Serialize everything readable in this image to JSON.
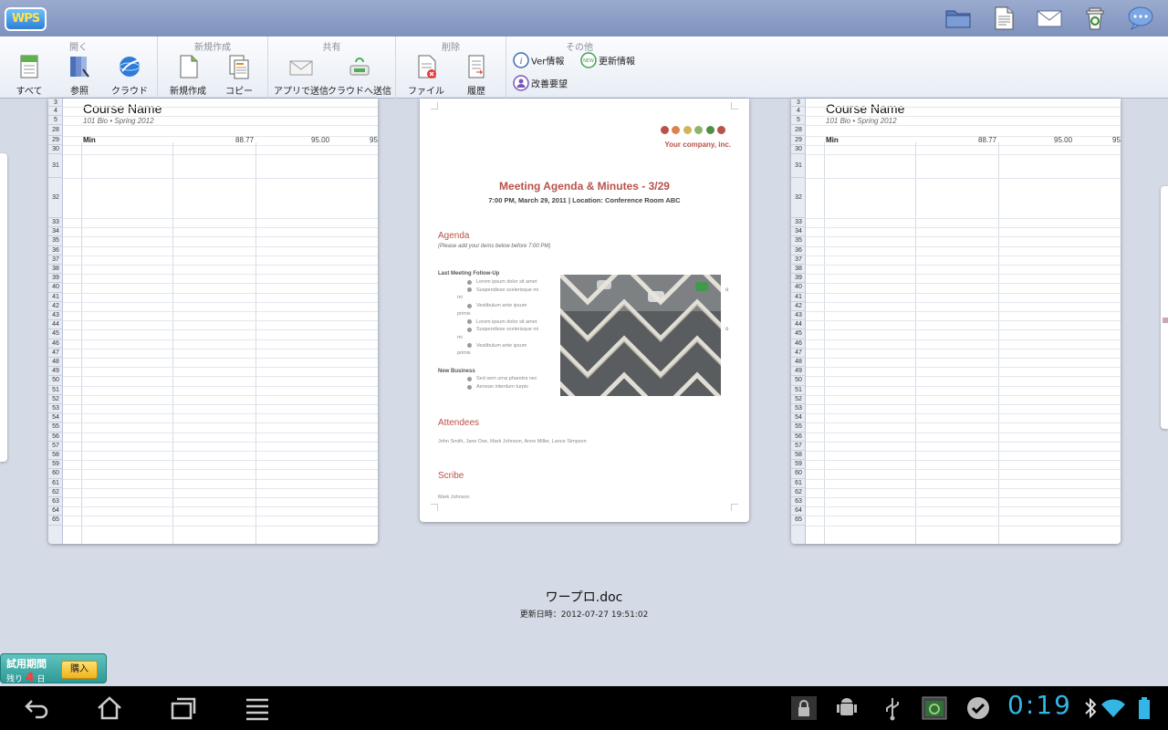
{
  "app": {
    "logo_text": "WPS"
  },
  "topbar_icons": [
    "folder-icon",
    "document-icon",
    "mail-icon",
    "recycle-bin-icon",
    "chat-bubble-icon"
  ],
  "ribbon": {
    "groups": [
      {
        "title": "開く",
        "buttons": [
          "すべて",
          "参照",
          "クラウド"
        ]
      },
      {
        "title": "新規作成",
        "buttons": [
          "新規作成",
          "コピー"
        ]
      },
      {
        "title": "共有",
        "buttons": [
          "アプリで送信",
          "クラウドへ送信"
        ]
      },
      {
        "title": "削除",
        "buttons": [
          "ファイル",
          "履歴"
        ]
      },
      {
        "title": "その他",
        "buttons": [
          "Ver情報",
          "更新情報",
          "改善要望"
        ]
      }
    ]
  },
  "sheet": {
    "title": "Course Name",
    "subtitle": "101 Bio • Spring 2012",
    "min_label": "Min",
    "values": [
      "88.77",
      "95.00",
      "95"
    ],
    "rows_top": [
      "3",
      "4",
      "5",
      "28",
      "29",
      "30",
      "31",
      "32"
    ],
    "rows": [
      "33",
      "34",
      "35",
      "36",
      "37",
      "38",
      "39",
      "40",
      "41",
      "42",
      "43",
      "44",
      "45",
      "46",
      "47",
      "48",
      "49",
      "50",
      "51",
      "52",
      "53",
      "54",
      "55",
      "56",
      "57",
      "58",
      "59",
      "60",
      "61",
      "62",
      "63",
      "64",
      "65"
    ]
  },
  "doc": {
    "company": "Your company, inc.",
    "dot_colors": [
      "#b8524a",
      "#d9834e",
      "#d2b55a",
      "#8db56d",
      "#4f8e48",
      "#b8524a"
    ],
    "title": "Meeting Agenda & Minutes - 3/29",
    "meta": "7:00 PM, March 29, 2011 | Location: Conference Room ABC",
    "agenda_heading": "Agenda",
    "agenda_note": "(Please add your items below before 7:00 PM)",
    "followup_heading": "Last Meeting Follow-Up",
    "followup_items": [
      "Lorem ipsum dolor sit amet",
      "Suspendisse scelerisque mi",
      "mi",
      "Vestibulum ante ipsum",
      "primis",
      "Lorem ipsum dolor sit amet",
      "Suspendisse scelerisque mi",
      "mi",
      "Vestibulum ante ipsum",
      "primis"
    ],
    "newbiz_heading": "New Business",
    "newbiz_items": [
      "Sed sem urna pharetra nec",
      "Aenean interdum turpis"
    ],
    "attendees_heading": "Attendees",
    "attendees": "John Smith, Jane Doe, Mark Johnson, Anne Miller, Lance Simpson",
    "scribe_heading": "Scribe",
    "scribe": "Mark Johnson"
  },
  "file": {
    "name": "ワープロ.doc",
    "modified": "更新日時：2012-07-27 19:51:02"
  },
  "trial": {
    "title": "試用期間",
    "remaining_prefix": "残り",
    "days": "4",
    "days_suffix": "日",
    "buy_label": "購入"
  },
  "system": {
    "clock": "0:19",
    "nav_icons": [
      "back-icon",
      "home-icon",
      "recent-apps-icon",
      "menu-icon"
    ],
    "status_icons": [
      "lock-icon",
      "android-debug-icon",
      "usb-icon",
      "screenshot-icon",
      "checkmark-icon",
      "bluetooth-icon",
      "wifi-icon",
      "battery-icon"
    ]
  }
}
